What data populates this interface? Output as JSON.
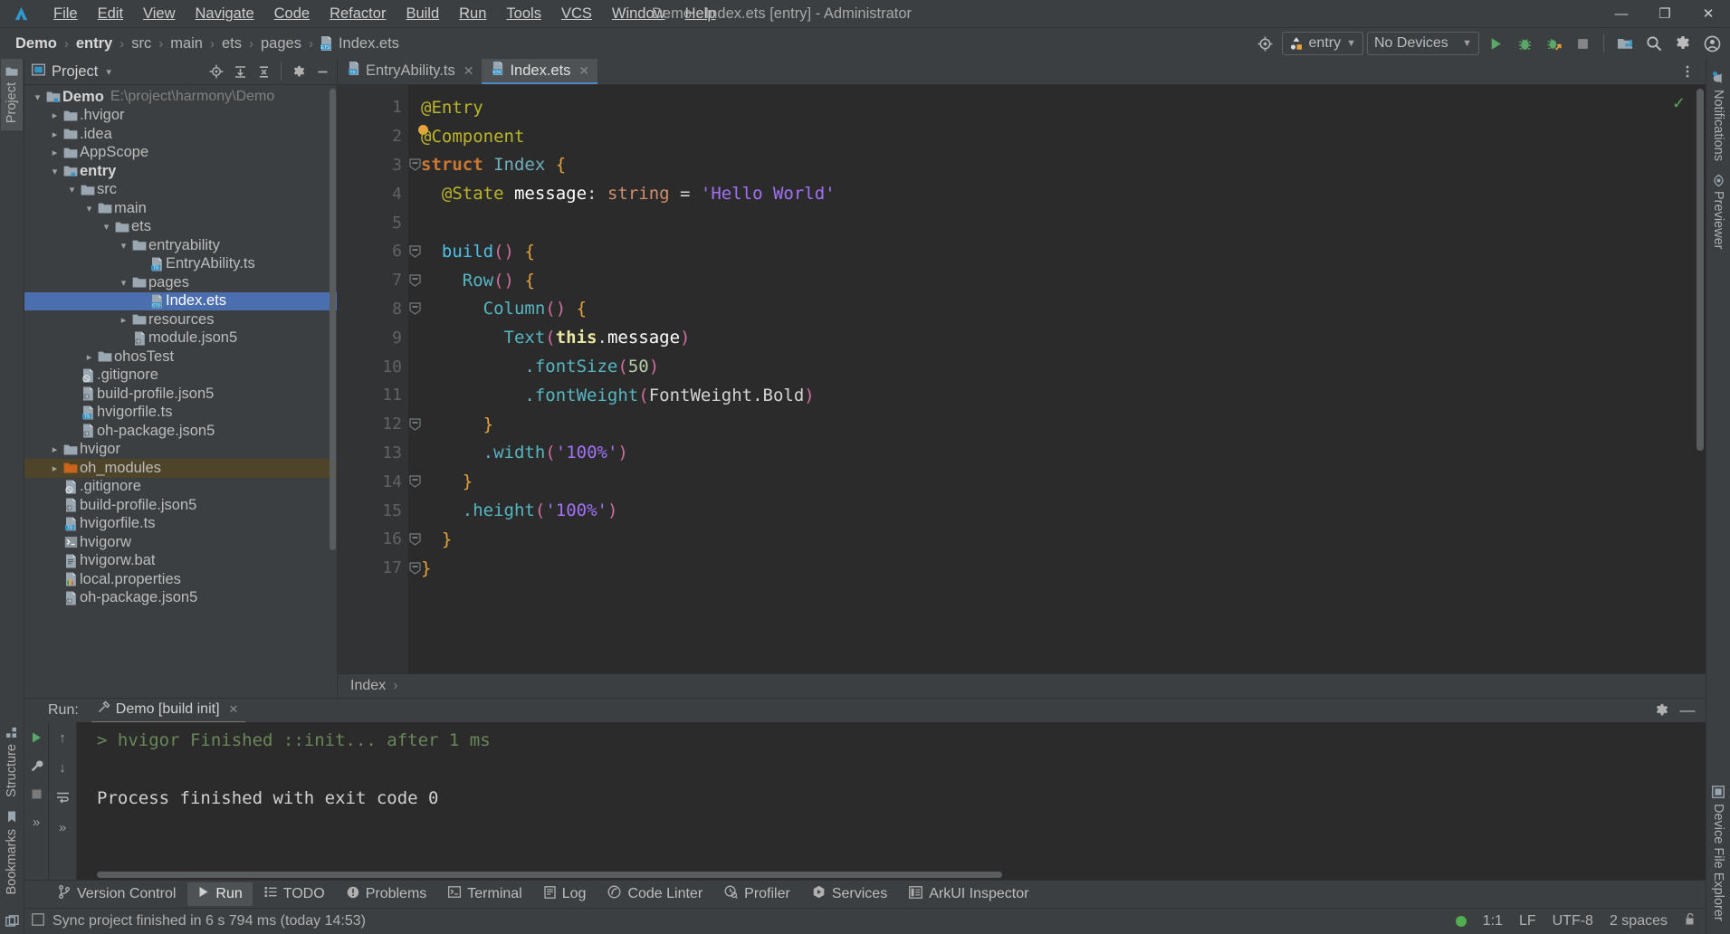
{
  "window": {
    "title": "Demo - Index.ets [entry] - Administrator",
    "minimize": "—",
    "maximize": "❐",
    "close": "✕"
  },
  "menu": {
    "items": [
      {
        "label": "File"
      },
      {
        "label": "Edit"
      },
      {
        "label": "View"
      },
      {
        "label": "Navigate"
      },
      {
        "label": "Code"
      },
      {
        "label": "Refactor"
      },
      {
        "label": "Build"
      },
      {
        "label": "Run"
      },
      {
        "label": "Tools"
      },
      {
        "label": "VCS"
      },
      {
        "label": "Window"
      },
      {
        "label": "Help"
      }
    ]
  },
  "navbar": {
    "breadcrumb": [
      "Demo",
      "entry",
      "src",
      "main",
      "ets",
      "pages",
      "Index.ets"
    ],
    "separator": "›",
    "run_config": "entry",
    "devices": "No Devices",
    "icons": {
      "target": "target-icon",
      "run": "run-icon",
      "debug": "debug-icon",
      "attach_debug": "attach-debugger-icon",
      "stop": "stop-icon",
      "device_manager": "device-manager-icon",
      "search": "search-icon",
      "settings": "gear-icon",
      "account": "account-icon"
    }
  },
  "left_strip": {
    "tabs": [
      {
        "label": "Project",
        "icon": "project-folder-icon",
        "active": true
      },
      {
        "label": "Structure",
        "icon": "structure-icon",
        "active": false
      },
      {
        "label": "Bookmarks",
        "icon": "bookmark-icon",
        "active": false
      }
    ]
  },
  "right_strip": {
    "tabs": [
      {
        "label": "Notifications",
        "icon": "notifications-icon"
      },
      {
        "label": "Previewer",
        "icon": "previewer-eye-icon"
      },
      {
        "label": "Device File Explorer",
        "icon": "device-file-explorer-icon"
      }
    ]
  },
  "project_panel": {
    "title": "Project",
    "dropdown_caret": "▾",
    "tools": [
      {
        "name": "locate-icon",
        "glyph": "⊕"
      },
      {
        "name": "expand-all-icon",
        "glyph": "≡"
      },
      {
        "name": "collapse-all-icon",
        "glyph": "≡"
      },
      {
        "name": "gear-icon",
        "glyph": "⚙"
      },
      {
        "name": "hide-icon",
        "glyph": "—"
      }
    ],
    "tree": [
      {
        "indent": 0,
        "twist": "⌄",
        "icon": "module-folder-icon",
        "label": "Demo",
        "bold": true,
        "path": "E:\\project\\harmony\\Demo"
      },
      {
        "indent": 1,
        "twist": "›",
        "icon": "folder-icon",
        "label": ".hvigor"
      },
      {
        "indent": 1,
        "twist": "›",
        "icon": "folder-icon",
        "label": ".idea"
      },
      {
        "indent": 1,
        "twist": "›",
        "icon": "folder-icon",
        "label": "AppScope"
      },
      {
        "indent": 1,
        "twist": "⌄",
        "icon": "module-folder-icon",
        "label": "entry",
        "bold": true
      },
      {
        "indent": 2,
        "twist": "⌄",
        "icon": "folder-icon",
        "label": "src"
      },
      {
        "indent": 3,
        "twist": "⌄",
        "icon": "folder-icon",
        "label": "main"
      },
      {
        "indent": 4,
        "twist": "⌄",
        "icon": "folder-icon",
        "label": "ets"
      },
      {
        "indent": 5,
        "twist": "⌄",
        "icon": "folder-icon",
        "label": "entryability"
      },
      {
        "indent": 6,
        "twist": "",
        "icon": "ts-file-icon",
        "label": "EntryAbility.ts"
      },
      {
        "indent": 5,
        "twist": "⌄",
        "icon": "folder-icon",
        "label": "pages"
      },
      {
        "indent": 6,
        "twist": "",
        "icon": "ets-file-icon",
        "label": "Index.ets",
        "selected": true
      },
      {
        "indent": 5,
        "twist": "›",
        "icon": "folder-icon",
        "label": "resources"
      },
      {
        "indent": 5,
        "twist": "",
        "icon": "json5-file-icon",
        "label": "module.json5"
      },
      {
        "indent": 3,
        "twist": "›",
        "icon": "folder-icon",
        "label": "ohosTest"
      },
      {
        "indent": 2,
        "twist": "",
        "icon": "gitignore-file-icon",
        "label": ".gitignore"
      },
      {
        "indent": 2,
        "twist": "",
        "icon": "json5-file-icon",
        "label": "build-profile.json5"
      },
      {
        "indent": 2,
        "twist": "",
        "icon": "ts-file-icon",
        "label": "hvigorfile.ts"
      },
      {
        "indent": 2,
        "twist": "",
        "icon": "json5-file-icon",
        "label": "oh-package.json5"
      },
      {
        "indent": 1,
        "twist": "›",
        "icon": "folder-icon",
        "label": "hvigor"
      },
      {
        "indent": 1,
        "twist": "›",
        "icon": "orange-folder-icon",
        "label": "oh_modules",
        "modified": true
      },
      {
        "indent": 1,
        "twist": "",
        "icon": "gitignore-file-icon",
        "label": ".gitignore"
      },
      {
        "indent": 1,
        "twist": "",
        "icon": "json5-file-icon",
        "label": "build-profile.json5"
      },
      {
        "indent": 1,
        "twist": "",
        "icon": "ts-file-icon",
        "label": "hvigorfile.ts"
      },
      {
        "indent": 1,
        "twist": "",
        "icon": "shell-file-icon",
        "label": "hvigorw"
      },
      {
        "indent": 1,
        "twist": "",
        "icon": "bat-file-icon",
        "label": "hvigorw.bat"
      },
      {
        "indent": 1,
        "twist": "",
        "icon": "properties-file-icon",
        "label": "local.properties"
      },
      {
        "indent": 1,
        "twist": "",
        "icon": "json5-file-icon",
        "label": "oh-package.json5"
      }
    ]
  },
  "editor": {
    "tabs": [
      {
        "label": "EntryAbility.ts",
        "icon": "ts-file-icon",
        "active": false,
        "close": "✕"
      },
      {
        "label": "Index.ets",
        "icon": "ets-file-icon",
        "active": true,
        "close": "✕"
      }
    ],
    "line_numbers": [
      "1",
      "2",
      "3",
      "4",
      "5",
      "6",
      "7",
      "8",
      "9",
      "10",
      "11",
      "12",
      "13",
      "14",
      "15",
      "16",
      "17"
    ],
    "breadcrumb": "Index",
    "breadcrumb_sep": "›",
    "inspection_ok": "✓",
    "code_lines": [
      {
        "n": 1,
        "fold": "",
        "tokens": [
          {
            "t": "@Entry",
            "c": "t-ann"
          }
        ]
      },
      {
        "n": 2,
        "fold": "",
        "breakpoint": true,
        "tokens": [
          {
            "t": "@Component",
            "c": "t-ann"
          }
        ]
      },
      {
        "n": 3,
        "fold": "minus",
        "tokens": [
          {
            "t": "struct",
            "c": "t-kw"
          },
          {
            "t": " ",
            "c": "t-plain"
          },
          {
            "t": "Index",
            "c": "t-type"
          },
          {
            "t": " ",
            "c": "t-plain"
          },
          {
            "t": "{",
            "c": "t-brace"
          }
        ]
      },
      {
        "n": 4,
        "fold": "",
        "tokens": [
          {
            "t": "  @State",
            "c": "t-ann"
          },
          {
            "t": " ",
            "c": "t-plain"
          },
          {
            "t": "message",
            "c": "t-white"
          },
          {
            "t": ": ",
            "c": "t-plain"
          },
          {
            "t": "string",
            "c": "t-kw2"
          },
          {
            "t": " = ",
            "c": "t-plain"
          },
          {
            "t": "'Hello World'",
            "c": "t-str"
          }
        ]
      },
      {
        "n": 5,
        "fold": "",
        "tokens": []
      },
      {
        "n": 6,
        "fold": "minus",
        "tokens": [
          {
            "t": "  ",
            "c": "t-plain"
          },
          {
            "t": "build",
            "c": "t-fn2"
          },
          {
            "t": "()",
            "c": "t-paren"
          },
          {
            "t": " ",
            "c": "t-plain"
          },
          {
            "t": "{",
            "c": "t-brace"
          }
        ]
      },
      {
        "n": 7,
        "fold": "minus",
        "tokens": [
          {
            "t": "    ",
            "c": "t-plain"
          },
          {
            "t": "Row",
            "c": "t-fn"
          },
          {
            "t": "()",
            "c": "t-paren"
          },
          {
            "t": " ",
            "c": "t-plain"
          },
          {
            "t": "{",
            "c": "t-brace"
          }
        ]
      },
      {
        "n": 8,
        "fold": "minus",
        "tokens": [
          {
            "t": "      ",
            "c": "t-plain"
          },
          {
            "t": "Column",
            "c": "t-fn"
          },
          {
            "t": "()",
            "c": "t-paren"
          },
          {
            "t": " ",
            "c": "t-plain"
          },
          {
            "t": "{",
            "c": "t-brace"
          }
        ]
      },
      {
        "n": 9,
        "fold": "",
        "tokens": [
          {
            "t": "        ",
            "c": "t-plain"
          },
          {
            "t": "Text",
            "c": "t-fn"
          },
          {
            "t": "(",
            "c": "t-paren"
          },
          {
            "t": "this",
            "c": "t-this"
          },
          {
            "t": ".",
            "c": "t-plain"
          },
          {
            "t": "message",
            "c": "t-white"
          },
          {
            "t": ")",
            "c": "t-paren"
          }
        ]
      },
      {
        "n": 10,
        "fold": "",
        "tokens": [
          {
            "t": "          ",
            "c": "t-plain"
          },
          {
            "t": ".",
            "c": "t-cyan"
          },
          {
            "t": "fontSize",
            "c": "t-fn"
          },
          {
            "t": "(",
            "c": "t-paren"
          },
          {
            "t": "50",
            "c": "t-num"
          },
          {
            "t": ")",
            "c": "t-paren"
          }
        ]
      },
      {
        "n": 11,
        "fold": "",
        "tokens": [
          {
            "t": "          ",
            "c": "t-plain"
          },
          {
            "t": ".",
            "c": "t-cyan"
          },
          {
            "t": "fontWeight",
            "c": "t-fn"
          },
          {
            "t": "(",
            "c": "t-paren"
          },
          {
            "t": "FontWeight",
            "c": "t-plain"
          },
          {
            "t": ".",
            "c": "t-plain"
          },
          {
            "t": "Bold",
            "c": "t-plain"
          },
          {
            "t": ")",
            "c": "t-paren"
          }
        ]
      },
      {
        "n": 12,
        "fold": "minus",
        "tokens": [
          {
            "t": "      ",
            "c": "t-plain"
          },
          {
            "t": "}",
            "c": "t-brace"
          }
        ]
      },
      {
        "n": 13,
        "fold": "",
        "tokens": [
          {
            "t": "      ",
            "c": "t-plain"
          },
          {
            "t": ".",
            "c": "t-cyan"
          },
          {
            "t": "width",
            "c": "t-fn"
          },
          {
            "t": "(",
            "c": "t-paren"
          },
          {
            "t": "'100%'",
            "c": "t-str"
          },
          {
            "t": ")",
            "c": "t-paren"
          }
        ]
      },
      {
        "n": 14,
        "fold": "minus",
        "tokens": [
          {
            "t": "    ",
            "c": "t-plain"
          },
          {
            "t": "}",
            "c": "t-brace"
          }
        ]
      },
      {
        "n": 15,
        "fold": "",
        "tokens": [
          {
            "t": "    ",
            "c": "t-plain"
          },
          {
            "t": ".",
            "c": "t-cyan"
          },
          {
            "t": "height",
            "c": "t-fn"
          },
          {
            "t": "(",
            "c": "t-paren"
          },
          {
            "t": "'100%'",
            "c": "t-str"
          },
          {
            "t": ")",
            "c": "t-paren"
          }
        ]
      },
      {
        "n": 16,
        "fold": "minus",
        "tokens": [
          {
            "t": "  ",
            "c": "t-plain"
          },
          {
            "t": "}",
            "c": "t-brace"
          }
        ]
      },
      {
        "n": 17,
        "fold": "minus",
        "tokens": [
          {
            "t": "}",
            "c": "t-brace"
          }
        ]
      }
    ]
  },
  "run_panel": {
    "label": "Run:",
    "tab_label": "Demo [build init]",
    "tab_icon": "hammer-icon",
    "tab_close": "✕",
    "gutter_icons": [
      {
        "name": "rerun-icon",
        "glyph": "▶"
      },
      {
        "name": "wrench-icon",
        "glyph": "⚒"
      },
      {
        "name": "stop-icon",
        "glyph": "■"
      },
      {
        "name": "expand-more-icon",
        "glyph": "»"
      }
    ],
    "gutter2_icons": [
      {
        "name": "scroll-up-icon",
        "glyph": "↑"
      },
      {
        "name": "scroll-down-icon",
        "glyph": "↓"
      },
      {
        "name": "soft-wrap-icon",
        "glyph": "↵"
      },
      {
        "name": "expand-more-icon-2",
        "glyph": "»"
      }
    ],
    "settings_icon": "gear-icon",
    "hide_icon": "—",
    "console_lines": [
      {
        "text": "> hvigor Finished ::init... after 1 ms",
        "color": "green"
      },
      {
        "text": "",
        "color": "conwhite"
      },
      {
        "text": "Process finished with exit code 0",
        "color": "conwhite"
      }
    ]
  },
  "toolwindow_bar": {
    "items": [
      {
        "label": "Version Control",
        "icon": "branch-icon",
        "active": false
      },
      {
        "label": "Run",
        "icon": "run-icon",
        "active": true
      },
      {
        "label": "TODO",
        "icon": "todo-list-icon",
        "active": false
      },
      {
        "label": "Problems",
        "icon": "problems-icon",
        "active": false
      },
      {
        "label": "Terminal",
        "icon": "terminal-icon",
        "active": false
      },
      {
        "label": "Log",
        "icon": "log-icon",
        "active": false
      },
      {
        "label": "Code Linter",
        "icon": "code-linter-icon",
        "active": false
      },
      {
        "label": "Profiler",
        "icon": "profiler-icon",
        "active": false
      },
      {
        "label": "Services",
        "icon": "services-icon",
        "active": false
      },
      {
        "label": "ArkUI Inspector",
        "icon": "arkui-inspector-icon",
        "active": false
      }
    ]
  },
  "statusbar": {
    "message": "Sync project finished in 6 s 794 ms (today 14:53)",
    "status_icon": "event-log-icon",
    "indicator_color": "#4fae4f",
    "caret": "1:1",
    "line_sep": "LF",
    "encoding": "UTF-8",
    "indent": "2 spaces",
    "lock_icon": "unlocked-icon"
  },
  "colors": {
    "accent": "#4b6eaf",
    "selection": "#4b6eaf",
    "modified_row": "#4e4429",
    "editor_bg": "#2b2b2b",
    "panel_bg": "#3c3f41",
    "green": "#6a8759"
  }
}
